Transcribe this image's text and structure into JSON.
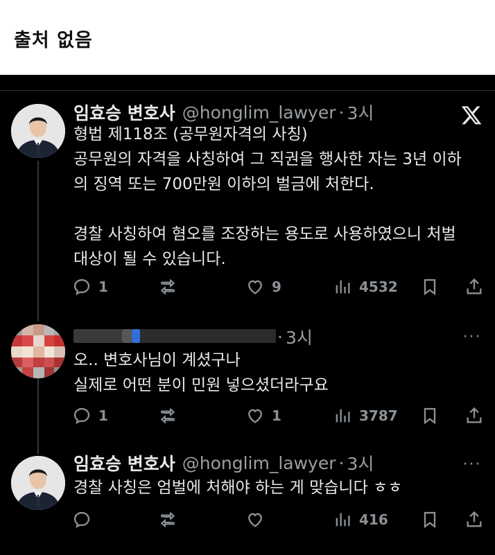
{
  "header": {
    "title": "출처 없음"
  },
  "posts": [
    {
      "name": "임효승 변호사",
      "handle": "@honglim_lawyer",
      "dot": "·",
      "time": "3시",
      "text": "형법 제118조 (공무원자격의 사칭)\n공무원의 자격을 사칭하여 그 직권을 행사한 자는 3년 이하\n의 징역 또는 700만원 이하의 벌금에 처한다.\n\n경찰 사칭하여 혐오를 조장하는 용도로 사용하였으니 처벌\n대상이 될 수 있습니다.",
      "replies": "1",
      "reposts": "",
      "likes": "9",
      "views": "4532"
    },
    {
      "name": "",
      "handle": "",
      "dot": "·",
      "time": "3시",
      "more": "···",
      "text": "오.. 변호사님이 계셨구나\n실제로 어떤 분이 민원 넣으셨더라구요",
      "replies": "1",
      "reposts": "",
      "likes": "1",
      "views": "3787"
    },
    {
      "name": "임효승 변호사",
      "handle": "@honglim_lawyer",
      "dot": "·",
      "time": "3시",
      "more": "···",
      "text": "경찰 사칭은 엄벌에 처해야 하는 게 맞습니다 ㅎㅎ",
      "replies": "",
      "reposts": "",
      "likes": "",
      "views": "416"
    }
  ],
  "colors": {
    "background": "#000000",
    "text": "#e7e9ea",
    "muted": "#8b9196",
    "divider": "#2f3336"
  }
}
